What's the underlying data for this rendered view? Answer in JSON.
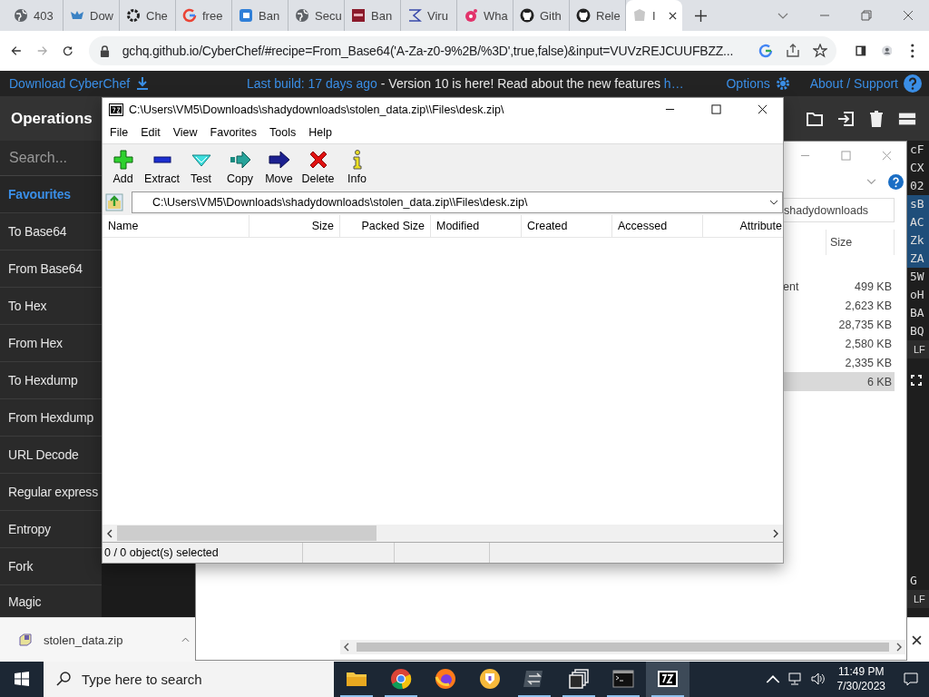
{
  "browser": {
    "tabs": [
      {
        "title": "403",
        "kind": "globe",
        "selected": false
      },
      {
        "title": "Dow",
        "kind": "mascot",
        "selected": false
      },
      {
        "title": "Che",
        "kind": "chef",
        "selected": false
      },
      {
        "title": "free",
        "kind": "google",
        "selected": false
      },
      {
        "title": "Ban",
        "kind": "banner",
        "selected": false
      },
      {
        "title": "Secu",
        "kind": "globe",
        "selected": false
      },
      {
        "title": "Ban",
        "kind": "square",
        "selected": false
      },
      {
        "title": "Viru",
        "kind": "sigma",
        "selected": false
      },
      {
        "title": "Wha",
        "kind": "pinwheel",
        "selected": false
      },
      {
        "title": "Gith",
        "kind": "github",
        "selected": false
      },
      {
        "title": "Rele",
        "kind": "github",
        "selected": false
      },
      {
        "title": "I",
        "kind": "paper",
        "selected": true
      }
    ],
    "url": "gchq.github.io/CyberChef/#recipe=From_Base64('A-Za-z0-9%2B/%3D',true,false)&input=VUVzREJCUUFBZZ..."
  },
  "cyberchef": {
    "download": "Download CyberChef",
    "build": "Last build: 17 days ago",
    "notice": " - Version 10 is here! Read about the new features ",
    "notice_link": "h…",
    "options": "Options",
    "about": "About / Support",
    "operations_title": "Operations",
    "search_placeholder": "Search...",
    "categories": [
      {
        "label": "Favourites",
        "kind": "heading"
      },
      {
        "label": "To Base64",
        "kind": "op"
      },
      {
        "label": "From Base64",
        "kind": "op"
      },
      {
        "label": "To Hex",
        "kind": "op"
      },
      {
        "label": "From Hex",
        "kind": "op"
      },
      {
        "label": "To Hexdump",
        "kind": "op"
      },
      {
        "label": "From Hexdump",
        "kind": "op"
      },
      {
        "label": "URL Decode",
        "kind": "op"
      },
      {
        "label": "Regular express",
        "kind": "op"
      },
      {
        "label": "Entropy",
        "kind": "op"
      },
      {
        "label": "Fork",
        "kind": "op"
      },
      {
        "label": "Magic",
        "kind": "op"
      }
    ],
    "output_lines": [
      {
        "text": "cF",
        "highlighted": false
      },
      {
        "text": "CX",
        "highlighted": false
      },
      {
        "text": "02",
        "highlighted": false
      },
      {
        "text": "sB",
        "highlighted": true
      },
      {
        "text": "AC",
        "highlighted": true
      },
      {
        "text": "Zk",
        "highlighted": true
      },
      {
        "text": "ZA",
        "highlighted": true
      },
      {
        "text": "5W",
        "highlighted": false
      },
      {
        "text": "oH",
        "highlighted": false
      },
      {
        "text": "BA",
        "highlighted": false
      },
      {
        "text": "BQ",
        "highlighted": false
      }
    ],
    "output_eol": "LF",
    "input_fragment": "G",
    "input_eol": "LF"
  },
  "explorer": {
    "address": "shadydownloads",
    "size_header": "Size",
    "rows": [
      {
        "name": "ent",
        "size": "499 KB",
        "selected": false
      },
      {
        "size": "2,623 KB",
        "selected": false
      },
      {
        "size": "28,735 KB",
        "selected": false
      },
      {
        "size": "2,580 KB",
        "selected": false
      },
      {
        "size": "2,335 KB",
        "selected": false
      },
      {
        "size": "6 KB",
        "selected": true
      }
    ]
  },
  "sevenzip": {
    "title": "C:\\Users\\VM5\\Downloads\\shadydownloads\\stolen_data.zip\\\\Files\\desk.zip\\",
    "menu": [
      "File",
      "Edit",
      "View",
      "Favorites",
      "Tools",
      "Help"
    ],
    "tools": [
      {
        "label": "Add",
        "kind": "add"
      },
      {
        "label": "Extract",
        "kind": "extract"
      },
      {
        "label": "Test",
        "kind": "test"
      },
      {
        "label": "Copy",
        "kind": "copy"
      },
      {
        "label": "Move",
        "kind": "move"
      },
      {
        "label": "Delete",
        "kind": "delete"
      },
      {
        "label": "Info",
        "kind": "info"
      }
    ],
    "path": "C:\\Users\\VM5\\Downloads\\shadydownloads\\stolen_data.zip\\\\Files\\desk.zip\\",
    "columns": [
      "Name",
      "Size",
      "Packed Size",
      "Modified",
      "Created",
      "Accessed",
      "Attribute"
    ],
    "status": "0 / 0 object(s) selected"
  },
  "downloads": {
    "file": "stolen_data.zip"
  },
  "taskbar": {
    "search_placeholder": "Type here to search",
    "apps": [
      {
        "kind": "folder",
        "running": true,
        "active": false
      },
      {
        "kind": "chrome",
        "running": true,
        "active": false
      },
      {
        "kind": "firefox",
        "running": false,
        "active": false
      },
      {
        "kind": "shield",
        "running": false,
        "active": false
      },
      {
        "kind": "arrows",
        "running": true,
        "active": false
      },
      {
        "kind": "windows",
        "running": true,
        "active": false
      },
      {
        "kind": "terminal",
        "running": true,
        "active": false
      },
      {
        "kind": "sevenzip",
        "running": true,
        "active": true
      }
    ],
    "time": "11:49 PM",
    "date": "7/30/2023"
  }
}
